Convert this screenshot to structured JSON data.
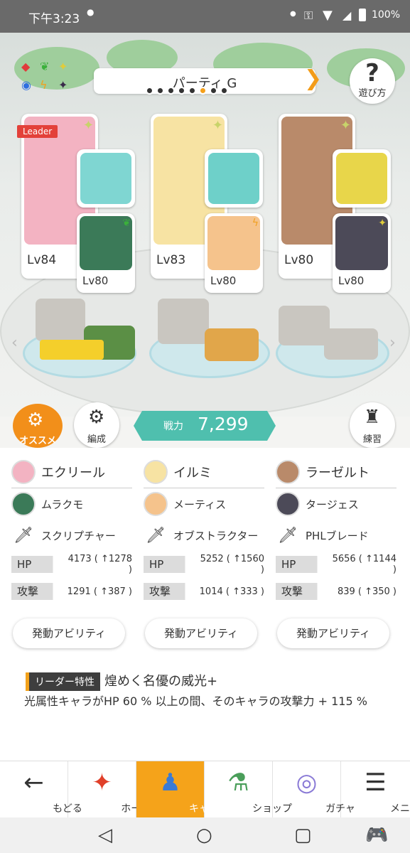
{
  "status": {
    "time": "下午3:23",
    "battery": "100%"
  },
  "party": {
    "title": "パーティ G",
    "page_count": 8,
    "active_page": 6
  },
  "help": {
    "label": "遊び方"
  },
  "leader_tag": "Leader",
  "members": [
    {
      "lv": "Lv84",
      "sub_lv": "Lv80",
      "name": "エクリール",
      "sub_name": "ムラクモ",
      "weapon": "スクリプチャー",
      "hp_label": "HP",
      "hp": "4173 ( ↑1278 )",
      "atk_label": "攻撃",
      "atk": "1291 ( ↑387 )",
      "ability": "発動アビリティ",
      "colors": {
        "portrait": "#f3b3c2",
        "weapon": "#7fd6d2",
        "sub": "#3b7a58"
      }
    },
    {
      "lv": "Lv83",
      "sub_lv": "Lv80",
      "name": "イルミ",
      "sub_name": "メーティス",
      "weapon": "オブストラクター",
      "hp_label": "HP",
      "hp": "5252 ( ↑1560 )",
      "atk_label": "攻撃",
      "atk": "1014 ( ↑333 )",
      "ability": "発動アビリティ",
      "colors": {
        "portrait": "#f7e3a3",
        "weapon": "#6ed0c9",
        "sub": "#f5c38c"
      }
    },
    {
      "lv": "Lv80",
      "sub_lv": "Lv80",
      "name": "ラーゼルト",
      "sub_name": "タージェス",
      "weapon": "PHLブレード",
      "hp_label": "HP",
      "hp": "5656 ( ↑1144 )",
      "atk_label": "攻撃",
      "atk": "839 ( ↑350 )",
      "ability": "発動アビリティ",
      "colors": {
        "portrait": "#b98a6a",
        "weapon": "#e8d64a",
        "sub": "#4c4a58"
      }
    }
  ],
  "controls": {
    "recommend": "オススメ",
    "formation": "編成",
    "power_label": "戦力",
    "power_value": "7,299",
    "practice": "練習"
  },
  "leader_skill": {
    "tag": "リーダー特性",
    "title": "煌めく名優の威光+",
    "desc": "光属性キャラがHP 60 % 以上の間、そのキャラの攻撃力 + 115 %"
  },
  "nav": [
    {
      "label": "もどる",
      "icon": "back-arrow-icon"
    },
    {
      "label": "ホーム",
      "icon": "home-icon"
    },
    {
      "label": "キャラ",
      "icon": "character-icon"
    },
    {
      "label": "ショップ",
      "icon": "shop-icon"
    },
    {
      "label": "ガチャ",
      "icon": "gacha-icon"
    },
    {
      "label": "メニュー",
      "icon": "menu-icon"
    }
  ]
}
